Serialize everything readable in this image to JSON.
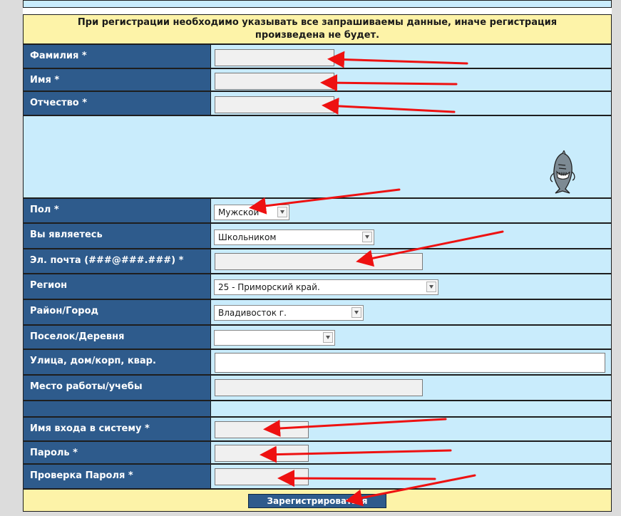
{
  "notice": {
    "line1": "При регистрации необходимо указывать все запрашиваемы данные, иначе регистрация",
    "line2": "произведена не будет."
  },
  "fields": {
    "surname": "Фамилия *",
    "name": "Имя *",
    "patronymic": "Отчество *",
    "gender": "Пол *",
    "you_are": "Вы являетесь",
    "email": "Эл. почта (###@###.###) *",
    "region": "Регион",
    "district": "Район/Город",
    "village": "Поселок/Деревня",
    "street": "Улица, дом/корп, квар.",
    "workplace": "Место работы/учебы",
    "login": "Имя входа в систему *",
    "password": "Пароль *",
    "password_check": "Проверка Пароля *"
  },
  "selects": {
    "gender": "Мужской",
    "you_are": "Школьником",
    "region": "25 - Приморский край.",
    "district": "Владивосток г.",
    "village": ""
  },
  "submit_label": "Зарегистрироваться",
  "colors": {
    "label_bg": "#2e5b8c",
    "value_bg": "#c9ecfc",
    "notice_bg": "#fdf3a8",
    "arrow": "#ee1111"
  }
}
